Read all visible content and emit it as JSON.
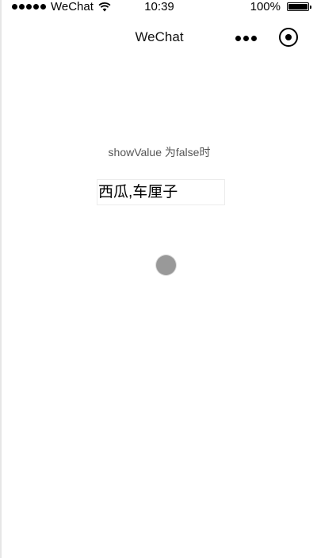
{
  "status_bar": {
    "carrier": "WeChat",
    "time": "10:39",
    "battery": "100%",
    "signal_icon": "signal-dots-icon",
    "wifi_icon": "wifi-icon",
    "battery_icon": "battery-icon"
  },
  "nav": {
    "title": "WeChat",
    "more_icon": "more-dots-icon",
    "close_icon": "capsule-close-icon"
  },
  "content": {
    "caption": "showValue 为false时",
    "picker_value": "西瓜,车厘子",
    "loading_indicator": "loading-dot-icon"
  },
  "colors": {
    "background": "#ffffff",
    "caption_text": "#555555",
    "field_border": "#ececec",
    "loader": "#999999"
  }
}
